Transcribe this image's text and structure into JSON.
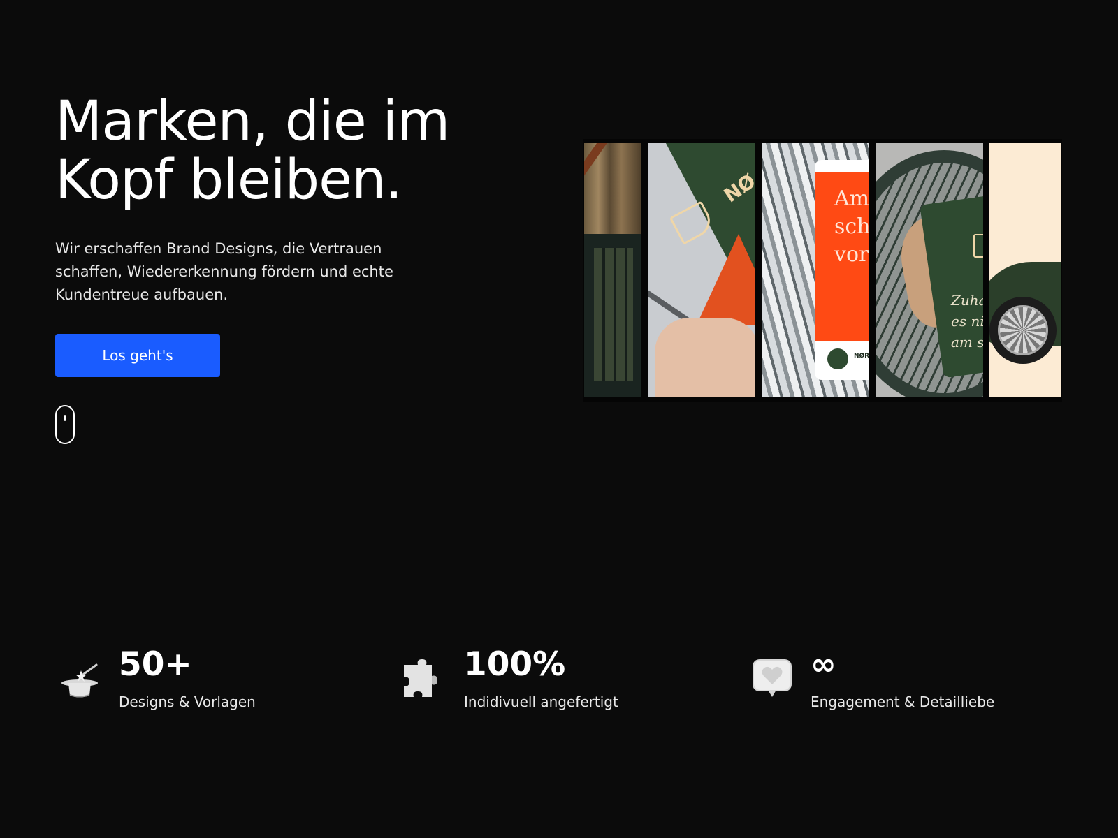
{
  "hero": {
    "title_lines": [
      "Marken, die im",
      "Kopf bleiben."
    ],
    "subtitle_lines": [
      "Wir erschaffen Brand Designs, die Vertrauen",
      "schaffen, Wiedererkennung fördern und echte",
      "Kundentreue aufbauen."
    ],
    "cta_label": "Los geht's"
  },
  "gallery": {
    "panel2": {
      "brand_text": "NØ"
    },
    "panel3": {
      "screen_lines": [
        "Am",
        "sch",
        "vor"
      ],
      "brand_text": "NØR"
    },
    "panel4": {
      "pillow_lines": [
        "Zuhau",
        "es nicl",
        "am scl"
      ]
    }
  },
  "stats": [
    {
      "icon": "magic-hat-icon",
      "value": "50+",
      "label": "Designs & Vorlagen"
    },
    {
      "icon": "puzzle-icon",
      "value": "100%",
      "label": "Indidivuell angefertigt"
    },
    {
      "icon": "heart-chat-icon",
      "value": "∞",
      "label": "Engagement & Detailliebe"
    }
  ],
  "colors": {
    "background": "#0b0b0b",
    "accent": "#1a5cff",
    "text": "#ffffff",
    "brand_green": "#2e4a30",
    "brand_orange": "#ff4a14"
  }
}
